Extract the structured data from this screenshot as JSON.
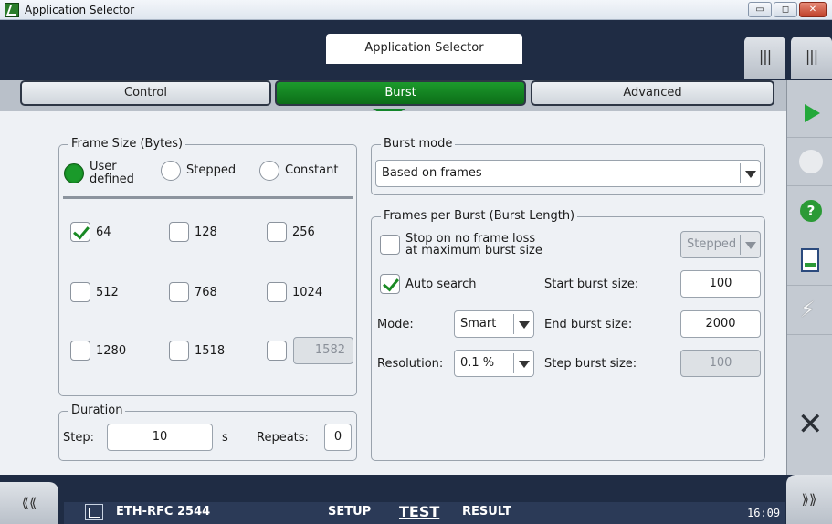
{
  "window": {
    "title": "Application Selector",
    "minimize": "▭",
    "maximize": "◻",
    "close": "✕"
  },
  "header": {
    "app_selector_tab": "Application Selector",
    "bars_left": "|||",
    "bars_right": "|||"
  },
  "tabs": [
    {
      "label": "Control",
      "active": false
    },
    {
      "label": "Burst",
      "active": true
    },
    {
      "label": "Advanced",
      "active": false
    }
  ],
  "frame_size": {
    "legend": "Frame Size (Bytes)",
    "modes": [
      {
        "label_line1": "User",
        "label_line2": "defined",
        "selected": true
      },
      {
        "label_line1": "Stepped",
        "label_line2": "",
        "selected": false
      },
      {
        "label_line1": "Constant",
        "label_line2": "",
        "selected": false
      }
    ],
    "sizes": [
      {
        "label": "64",
        "checked": true
      },
      {
        "label": "128",
        "checked": false
      },
      {
        "label": "256",
        "checked": false
      },
      {
        "label": "512",
        "checked": false
      },
      {
        "label": "768",
        "checked": false
      },
      {
        "label": "1024",
        "checked": false
      },
      {
        "label": "1280",
        "checked": false
      },
      {
        "label": "1518",
        "checked": false
      }
    ],
    "custom_value": "1582"
  },
  "duration": {
    "legend": "Duration",
    "step_label": "Step:",
    "step_value": "10",
    "step_unit": "s",
    "repeats_label": "Repeats:",
    "repeats_value": "0"
  },
  "burst_mode": {
    "legend": "Burst mode",
    "value": "Based on frames"
  },
  "frames_per_burst": {
    "legend": "Frames per Burst (Burst Length)",
    "stop_label_line1": "Stop on no frame loss",
    "stop_label_line2": "at maximum burst size",
    "stop_checked": false,
    "stop_mode_value": "Stepped",
    "auto_search_label": "Auto search",
    "auto_search_checked": true,
    "mode_label": "Mode:",
    "mode_value": "Smart",
    "resolution_label": "Resolution:",
    "resolution_value": "0.1 %",
    "start_label": "Start burst size:",
    "start_value": "100",
    "end_label": "End burst size:",
    "end_value": "2000",
    "step_label": "Step burst size:",
    "step_value": "100"
  },
  "side_panel": {
    "help": "?",
    "bolt": "⚡",
    "close": "✕"
  },
  "bottom": {
    "nav_left": "⟪⟪",
    "nav_right": "⟫⟫",
    "test_name": "ETH-RFC 2544",
    "setup": "SETUP",
    "test": "TEST",
    "result": "RESULT",
    "time": "16:09"
  }
}
